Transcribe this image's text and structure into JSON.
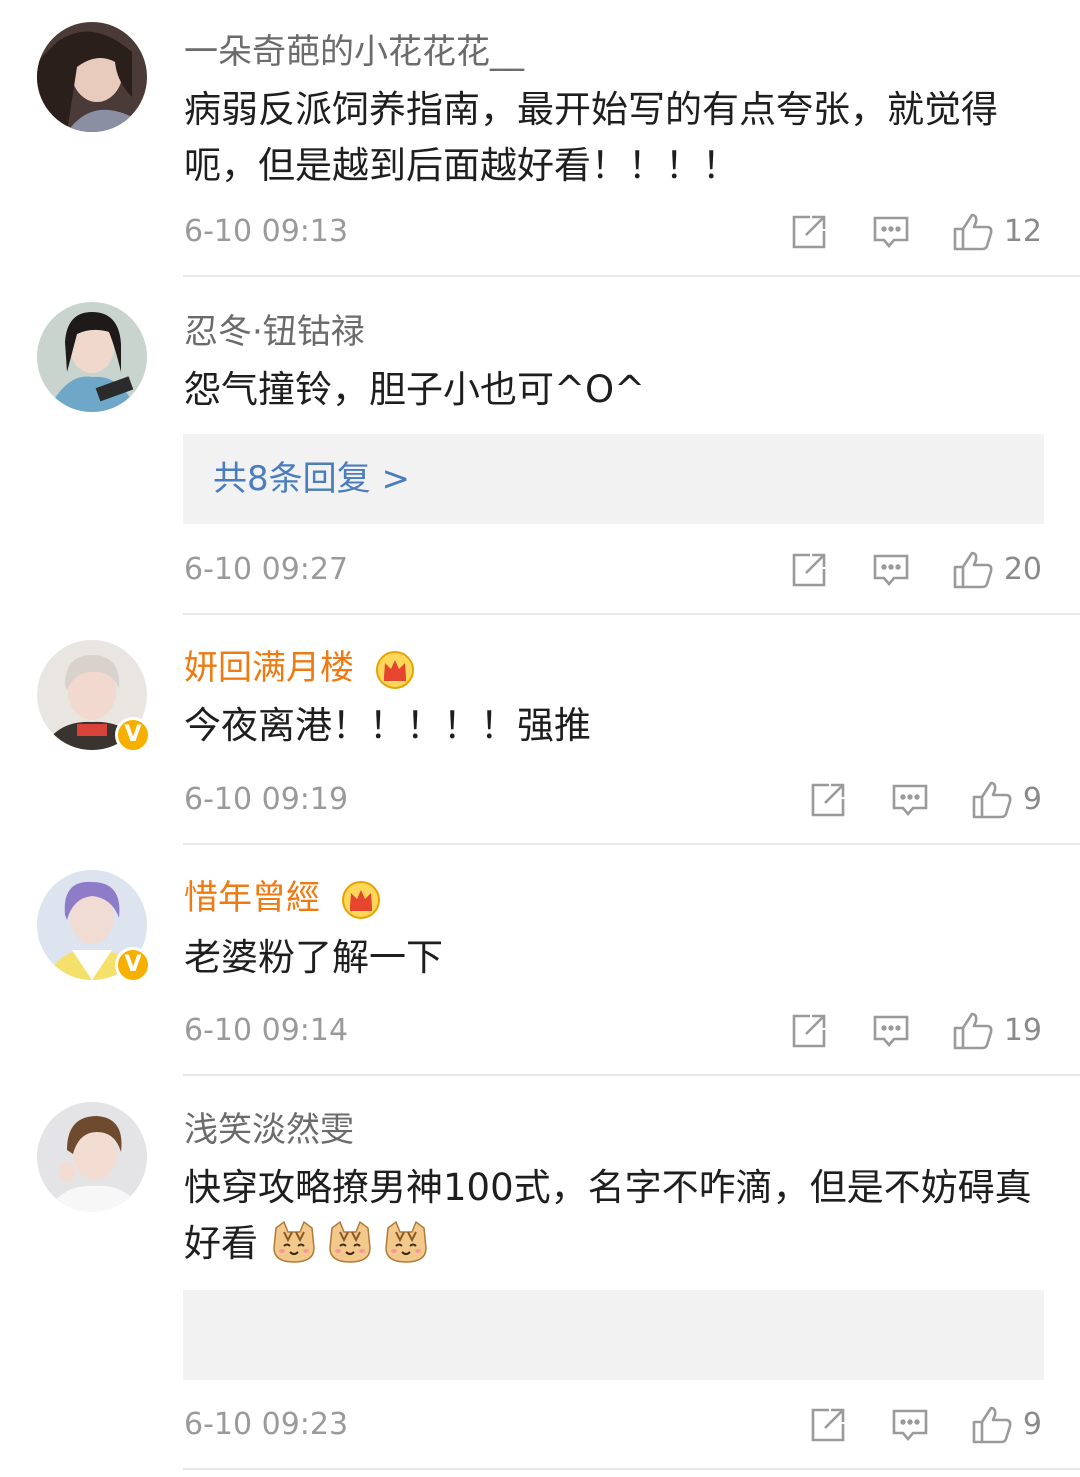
{
  "comments": [
    {
      "username": "一朵奇葩的小花花花__",
      "text": "病弱反派饲养指南，最开始写的有点夸张，就觉得呃，但是越到后面越好看！！！！",
      "timestamp": "6-10 09:13",
      "likes": "12"
    },
    {
      "username": "忍冬·钮钴禄",
      "text": "怨气撞铃，胆子小也可^O^",
      "reply_link": "共8条回复 >",
      "timestamp": "6-10 09:27",
      "likes": "20"
    },
    {
      "username": "妍回满月楼",
      "text": "今夜离港！！！！！强推",
      "timestamp": "6-10 09:19",
      "likes": "9"
    },
    {
      "username": "惜年曾經",
      "text": "老婆粉了解一下",
      "timestamp": "6-10 09:14",
      "likes": "19"
    },
    {
      "username": "浅笑淡然雯",
      "text": "快穿攻略撩男神100式，名字不咋滴，但是不妨碍真好看",
      "timestamp": "6-10 09:23",
      "likes": "9"
    }
  ],
  "colors": {
    "vip_name": "#f07a12",
    "reply_link": "#4a7dbf",
    "verified_badge": "#f8b000"
  },
  "icons": [
    "repost-icon",
    "comment-icon",
    "like-icon",
    "crown-icon",
    "verified-icon",
    "cat-emoji"
  ]
}
